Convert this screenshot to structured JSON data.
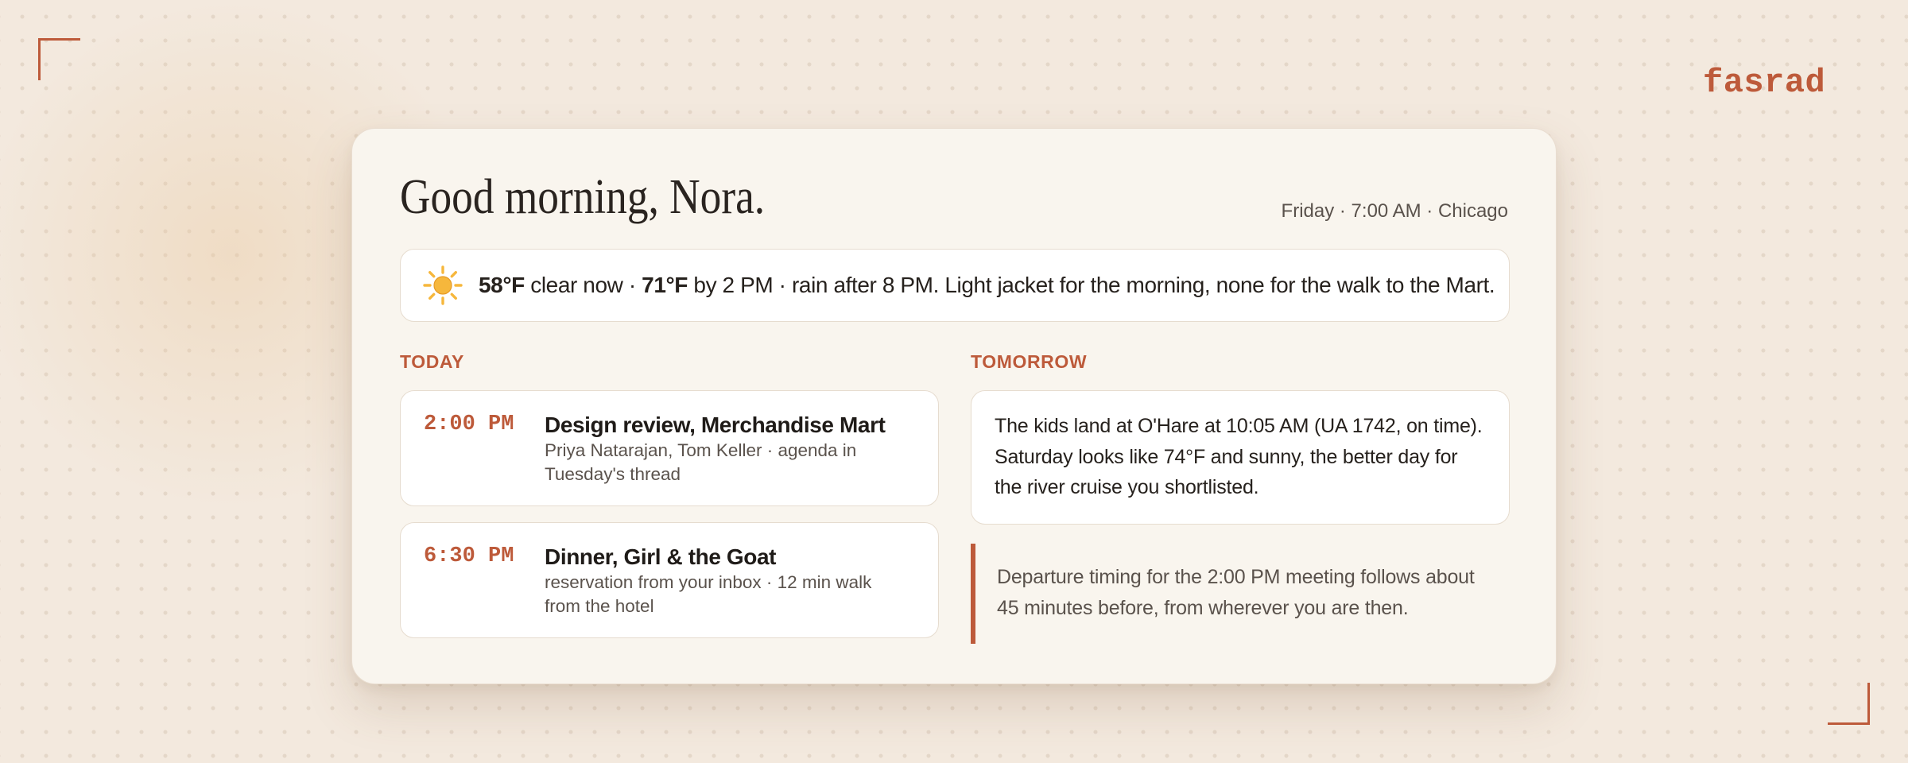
{
  "brand": "fasrad",
  "header": {
    "greeting": "Good morning, Nora.",
    "datetime": "Friday · 7:00 AM · Chicago"
  },
  "weather": {
    "icon": "sun-icon",
    "current_temp": "58°F",
    "current_desc": " clear now · ",
    "later_temp": "71°F",
    "later_desc": " by 2 PM · rain after 8 PM. Light jacket for the morning, none for the walk to the Mart."
  },
  "today": {
    "label": "TODAY",
    "events": [
      {
        "time": "2:00 PM",
        "title": "Design review, Merchandise Mart",
        "subtitle": "Priya Natarajan, Tom Keller · agenda in Tuesday's thread"
      },
      {
        "time": "6:30 PM",
        "title": "Dinner, Girl & the Goat",
        "subtitle": "reservation from your inbox · 12 min walk from the hotel"
      }
    ]
  },
  "tomorrow": {
    "label": "TOMORROW",
    "text": "The kids land at O'Hare at 10:05 AM (UA 1742, on time). Saturday looks like 74°F and sunny, the better day for the river cruise you shortlisted."
  },
  "note": "Departure timing for the 2:00 PM meeting follows about 45 minutes before, from wherever you are then.",
  "colors": {
    "accent": "#bd5a3a",
    "background": "#f3e9de",
    "card": "#f9f5ee",
    "sun": "#f6b73c"
  }
}
